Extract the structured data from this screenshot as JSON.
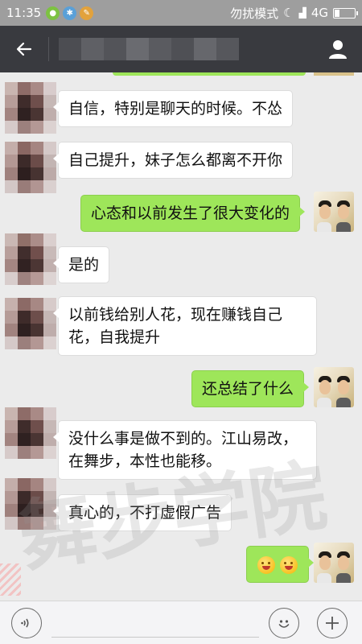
{
  "status_bar": {
    "time": "11:35",
    "carrier_text": "勿扰模式",
    "network": "4G"
  },
  "header": {
    "title": ""
  },
  "messages": [
    {
      "side": "left",
      "text": "自信，特别是聊天的时候。不怂"
    },
    {
      "side": "left",
      "text": "自己提升，妹子怎么都离不开你"
    },
    {
      "side": "right",
      "text": "心态和以前发生了很大变化的"
    },
    {
      "side": "left",
      "text": "是的"
    },
    {
      "side": "left",
      "text": "以前钱给别人花，现在赚钱自己花，自我提升"
    },
    {
      "side": "right",
      "text": "还总结了什么"
    },
    {
      "side": "left",
      "text": "没什么事是做不到的。江山易改，在舞步，本性也能移。"
    },
    {
      "side": "left",
      "text": "真心的，不打虚假广告"
    },
    {
      "side": "right",
      "text": "",
      "emoji": [
        "grinning-emoji",
        "grinning-emoji"
      ]
    }
  ],
  "watermark": {
    "text": "舞步学院"
  },
  "input": {
    "value": "",
    "placeholder": ""
  },
  "colors": {
    "title_bar": "#393a3f",
    "status_bar": "#9e9e9e",
    "my_bubble": "#9ee65a",
    "their_bubble": "#ffffff",
    "chat_bg": "#ebebeb"
  }
}
